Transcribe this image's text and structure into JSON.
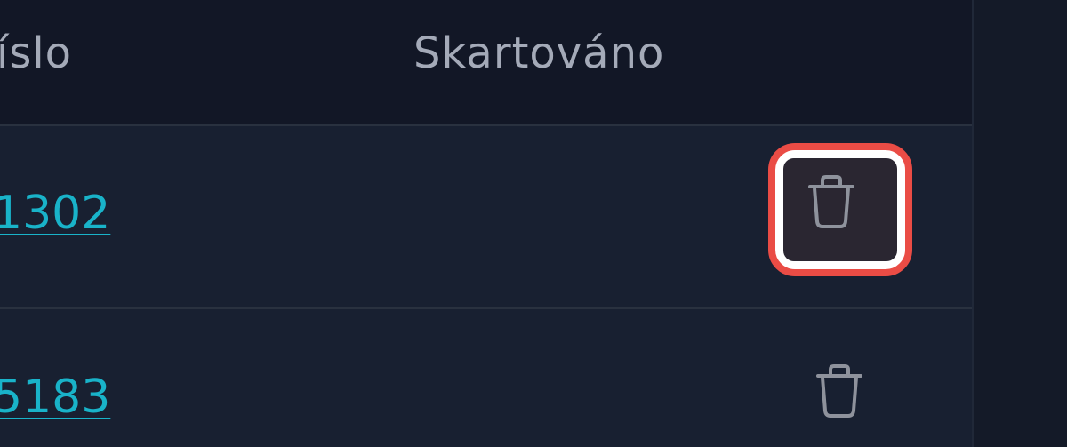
{
  "table": {
    "headers": {
      "number": "íslo",
      "shredded": "Skartováno"
    },
    "rows": [
      {
        "number": "1302",
        "delete_icon": "trash-icon",
        "highlighted": true
      },
      {
        "number": "5183",
        "delete_icon": "trash-icon",
        "highlighted": false
      }
    ]
  },
  "colors": {
    "background": "#141a28",
    "header_bg": "#121726",
    "row_bg": "#182031",
    "link": "#19b3c9",
    "header_text": "#a4aab8",
    "highlight_border": "#ea4c45",
    "icon": "#8e929c"
  }
}
